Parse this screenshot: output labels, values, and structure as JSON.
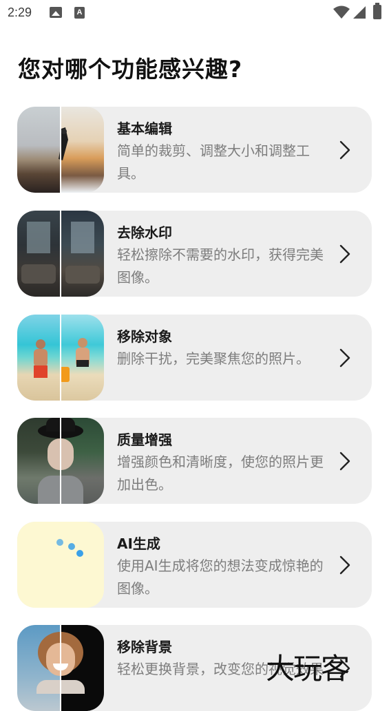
{
  "status_bar": {
    "time": "2:29",
    "icons": [
      "gallery-icon",
      "a-icon",
      "wifi-icon",
      "signal-icon",
      "battery-icon"
    ]
  },
  "page": {
    "title": "您对哪个功能感兴趣?"
  },
  "features": [
    {
      "title": "基本编辑",
      "description": "简单的裁剪、调整大小和调整工具。",
      "icon": "basic-edit-thumbnail"
    },
    {
      "title": "去除水印",
      "description": "轻松擦除不需要的水印，获得完美图像。",
      "icon": "watermark-removal-thumbnail"
    },
    {
      "title": "移除对象",
      "description": "删除干扰，完美聚焦您的照片。",
      "icon": "object-removal-thumbnail"
    },
    {
      "title": "质量增强",
      "description": "增强颜色和清晰度，使您的照片更加出色。",
      "icon": "quality-enhance-thumbnail"
    },
    {
      "title": "AI生成",
      "description": "使用AI生成将您的想法变成惊艳的图像。",
      "icon": "ai-generate-thumbnail"
    },
    {
      "title": "移除背景",
      "description": "轻松更换背景，改变您的视觉效果",
      "icon": "background-removal-thumbnail"
    }
  ],
  "watermark": {
    "text": "大玩客"
  },
  "colors": {
    "card_bg": "#eeeeee",
    "description_text": "#7d7d7d",
    "ai_thumb_bg": "#fdf8d2",
    "ai_dots": "#3aa0e8"
  }
}
